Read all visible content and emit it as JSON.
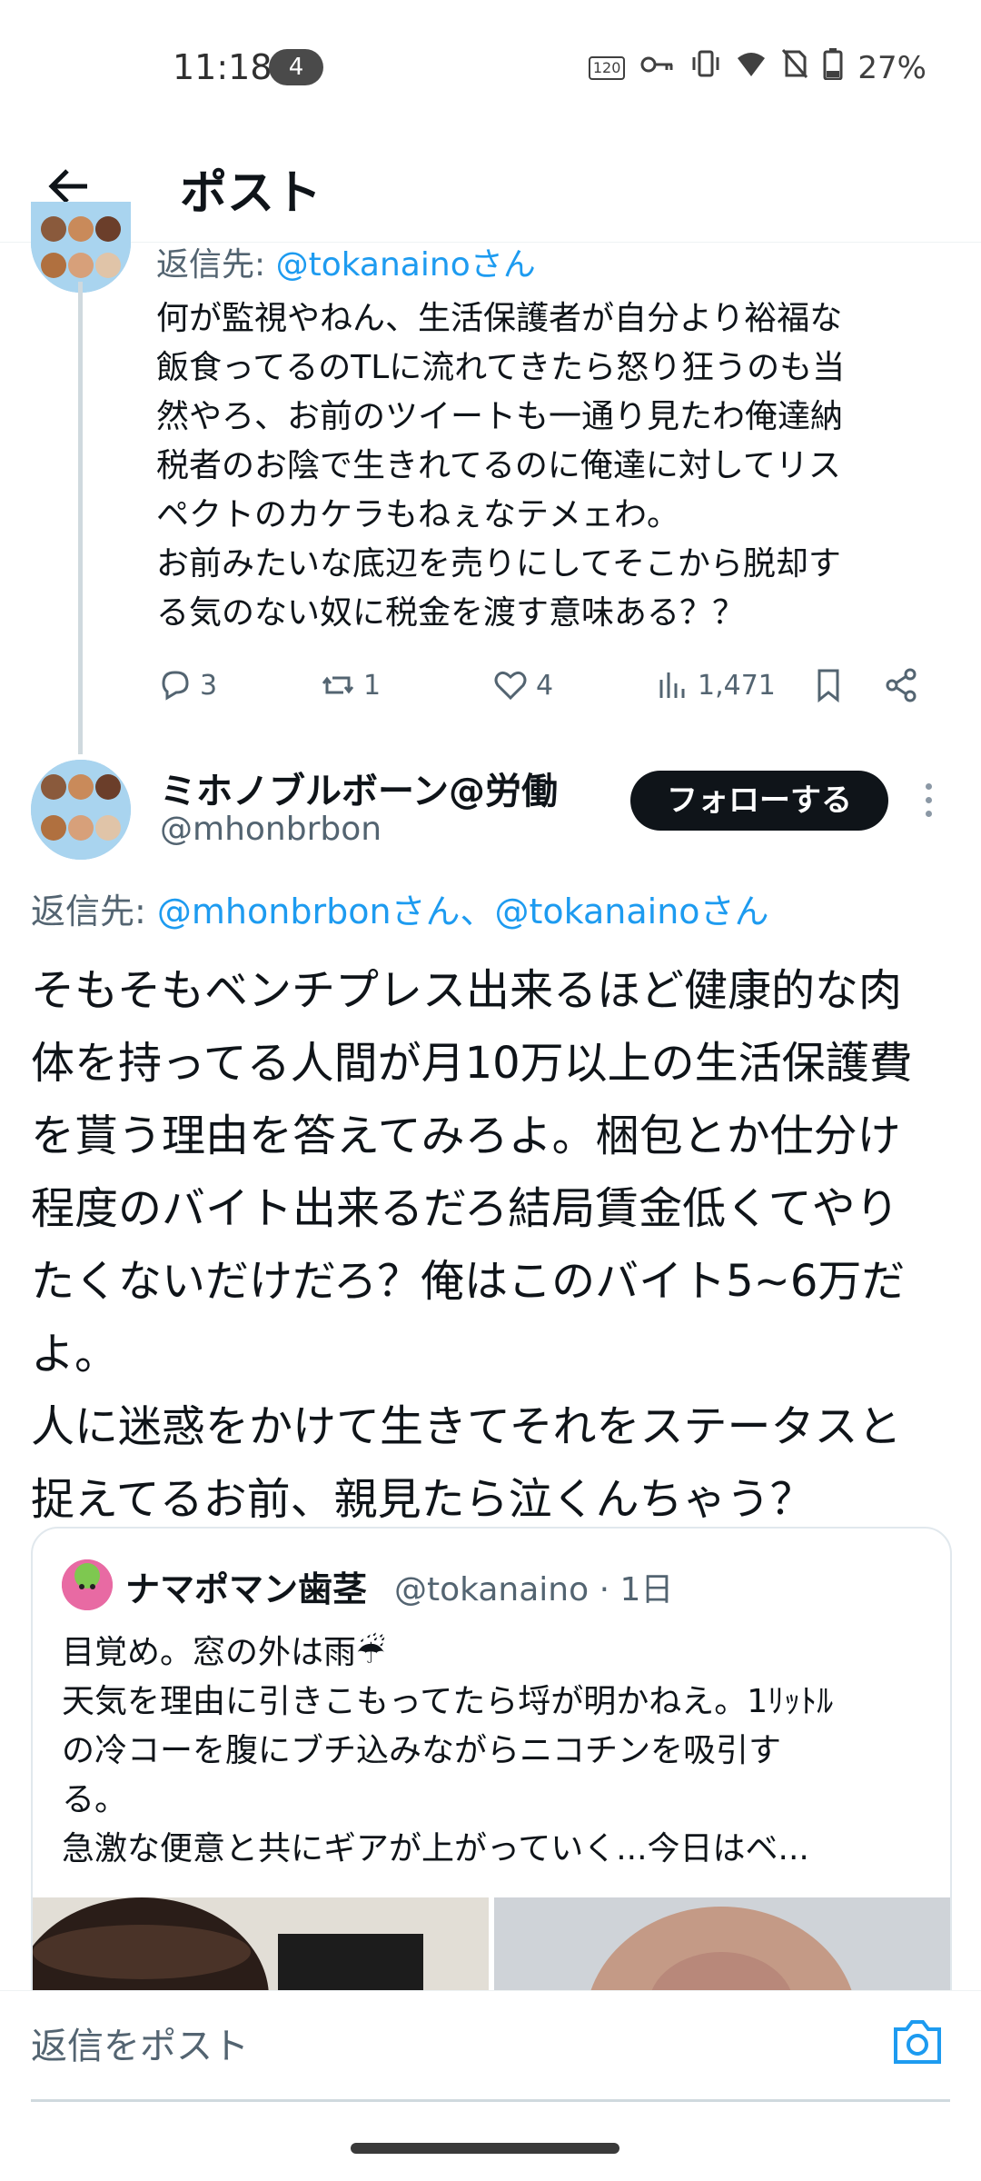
{
  "status_bar": {
    "time": "11:18",
    "notification_count": "4",
    "refresh_rate": "120",
    "battery": "27%"
  },
  "header": {
    "title": "ポスト"
  },
  "tweet_parent": {
    "reply_prefix": "返信先: ",
    "reply_handle": "@tokanainoさん",
    "text": "何が監視やねん、生活保護者が自分より裕福な\n飯食ってるのTLに流れてきたら怒り狂うのも当\n然やろ、お前のツイートも一通り見たわ俺達納\n税者のお陰で生きれてるのに俺達に対してリス\nペクトのカケラもねぇなテメェわ。\nお前みたいな底辺を売りにしてそこから脱却す\nる気のない奴に税金を渡す意味ある？？",
    "replies": "3",
    "reposts": "1",
    "likes": "4",
    "views": "1,471"
  },
  "tweet_main": {
    "author_name": "ミホノブルボーン@労働",
    "author_handle": "@mhonbrbon",
    "follow_label": "フォローする",
    "reply_prefix": "返信先: ",
    "reply_handles": "@mhonbrbonさん、@tokanainoさん",
    "text": "そもそもベンチプレス出来るほど健康的な肉\n体を持ってる人間が月10万以上の生活保護費\nを貰う理由を答えてみろよ。梱包とか仕分け\n程度のバイト出来るだろ結局賃金低くてやり\nたくないだけだろ？俺はこのバイト5~6万だ\nよ。\n人に迷惑をかけて生きてそれをステータスと\n捉えてるお前、親見たら泣くんちゃう？"
  },
  "quote": {
    "author_name": "ナマポマン歯茎",
    "author_handle": "@tokanaino · 1日",
    "text_line1": "目覚め。窓の外は雨☔",
    "text_rest": "天気を理由に引きこもってたら埒が明かねえ。1ﾘｯﾄﾙ\nの冷コーを腹にブチ込みながらニコチンを吸引す\nる。\n急激な便意と共にギアが上がっていく...今日はベ..."
  },
  "composer": {
    "placeholder": "返信をポスト"
  },
  "colors": {
    "link": "#1d9bf0",
    "text": "#0f1419",
    "muted": "#536471",
    "follow_bg": "#0f1419"
  }
}
